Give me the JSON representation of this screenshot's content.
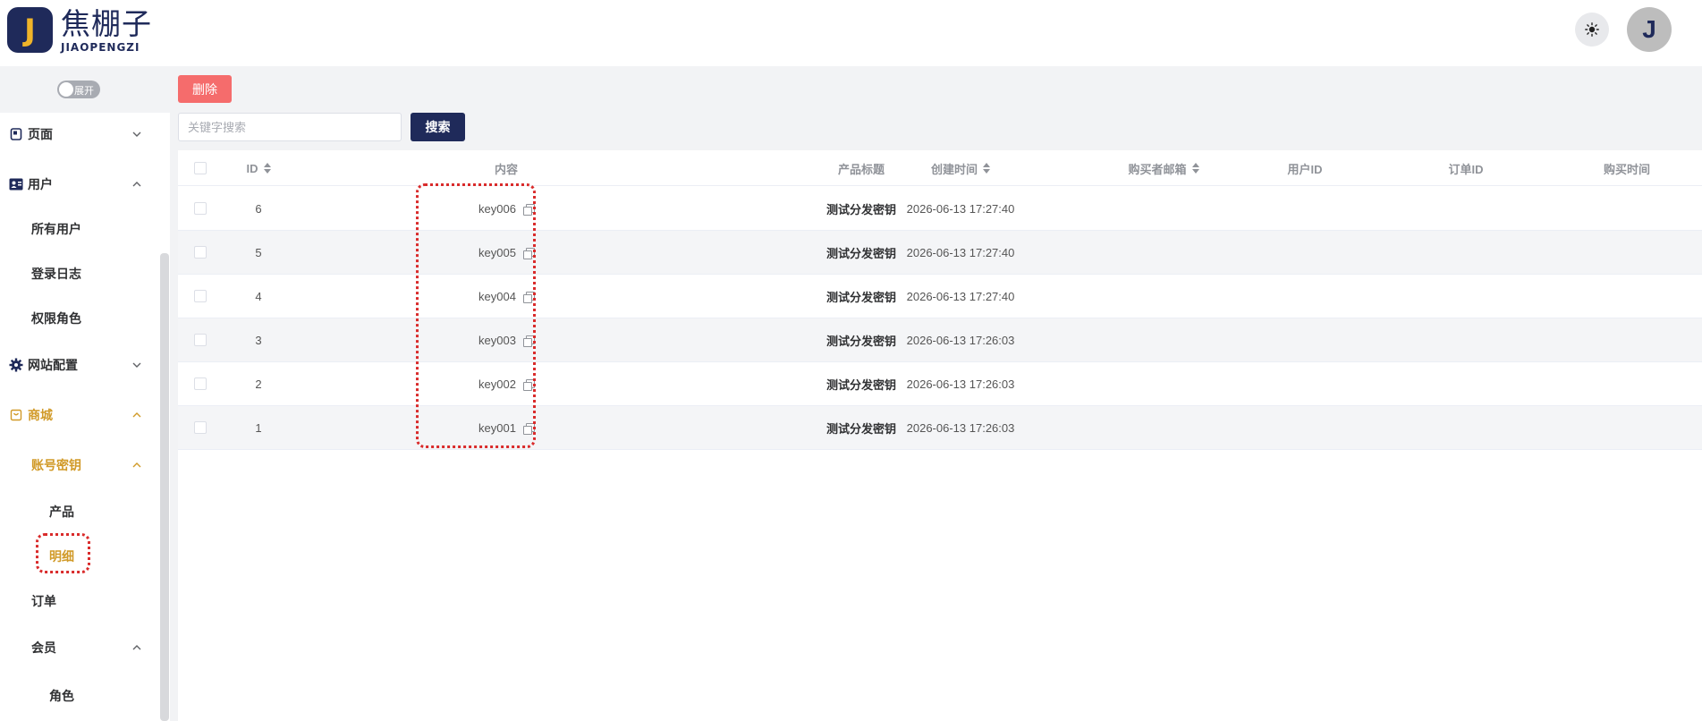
{
  "header": {
    "logo_letter": "J",
    "logo_cn": "焦棚子",
    "logo_en": "JIAOPENGZI",
    "avatar_letter": "J"
  },
  "sidebar": {
    "toggle_label": "展开",
    "items": [
      {
        "label": "页面",
        "icon": "page-icon",
        "expanded": false
      },
      {
        "label": "用户",
        "icon": "user-card-icon",
        "expanded": true
      },
      {
        "label": "所有用户"
      },
      {
        "label": "登录日志"
      },
      {
        "label": "权限角色"
      },
      {
        "label": "网站配置",
        "icon": "gear-icon",
        "expanded": false
      },
      {
        "label": "商城",
        "icon": "shop-icon",
        "expanded": true,
        "active": true
      },
      {
        "label": "账号密钥",
        "expanded": true,
        "active": true
      },
      {
        "label": "产品"
      },
      {
        "label": "明细",
        "active": true
      },
      {
        "label": "订单"
      },
      {
        "label": "会员",
        "expanded": true
      },
      {
        "label": "角色"
      }
    ]
  },
  "toolbar": {
    "delete_label": "删除",
    "search_placeholder": "关键字搜索",
    "search_value": "",
    "search_label": "搜索"
  },
  "table": {
    "columns": [
      "ID",
      "内容",
      "产品标题",
      "创建时间",
      "购买者邮箱",
      "用户ID",
      "订单ID",
      "购买时间"
    ],
    "rows": [
      {
        "id": "6",
        "content": "key006",
        "product": "测试分发密钥",
        "created": "2026-06-13 17:27:40",
        "email": "",
        "user_id": "",
        "order_id": "",
        "purchased": ""
      },
      {
        "id": "5",
        "content": "key005",
        "product": "测试分发密钥",
        "created": "2026-06-13 17:27:40",
        "email": "",
        "user_id": "",
        "order_id": "",
        "purchased": ""
      },
      {
        "id": "4",
        "content": "key004",
        "product": "测试分发密钥",
        "created": "2026-06-13 17:27:40",
        "email": "",
        "user_id": "",
        "order_id": "",
        "purchased": ""
      },
      {
        "id": "3",
        "content": "key003",
        "product": "测试分发密钥",
        "created": "2026-06-13 17:26:03",
        "email": "",
        "user_id": "",
        "order_id": "",
        "purchased": ""
      },
      {
        "id": "2",
        "content": "key002",
        "product": "测试分发密钥",
        "created": "2026-06-13 17:26:03",
        "email": "",
        "user_id": "",
        "order_id": "",
        "purchased": ""
      },
      {
        "id": "1",
        "content": "key001",
        "product": "测试分发密钥",
        "created": "2026-06-13 17:26:03",
        "email": "",
        "user_id": "",
        "order_id": "",
        "purchased": ""
      }
    ]
  },
  "colors": {
    "brand": "#1f2a5a",
    "accent": "#d19a28",
    "danger": "#f56c6c",
    "annotation": "#d92b2b"
  }
}
